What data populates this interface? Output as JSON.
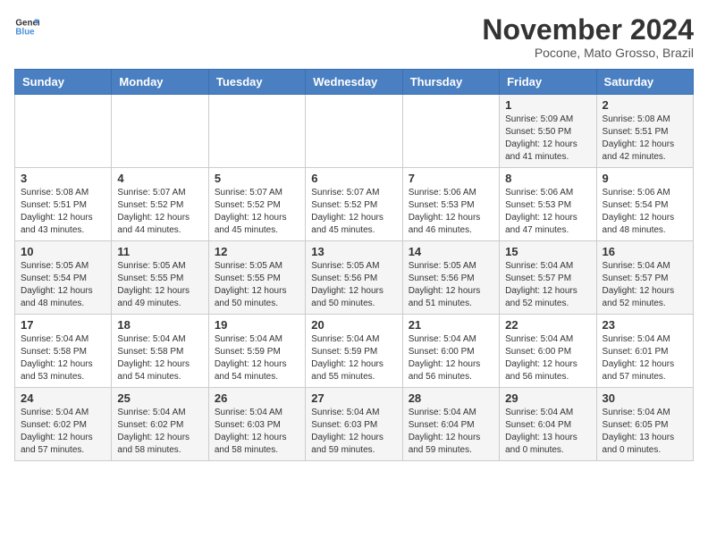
{
  "logo": {
    "line1": "General",
    "line2": "Blue"
  },
  "title": "November 2024",
  "subtitle": "Pocone, Mato Grosso, Brazil",
  "weekdays": [
    "Sunday",
    "Monday",
    "Tuesday",
    "Wednesday",
    "Thursday",
    "Friday",
    "Saturday"
  ],
  "weeks": [
    [
      {
        "day": "",
        "info": ""
      },
      {
        "day": "",
        "info": ""
      },
      {
        "day": "",
        "info": ""
      },
      {
        "day": "",
        "info": ""
      },
      {
        "day": "",
        "info": ""
      },
      {
        "day": "1",
        "info": "Sunrise: 5:09 AM\nSunset: 5:50 PM\nDaylight: 12 hours\nand 41 minutes."
      },
      {
        "day": "2",
        "info": "Sunrise: 5:08 AM\nSunset: 5:51 PM\nDaylight: 12 hours\nand 42 minutes."
      }
    ],
    [
      {
        "day": "3",
        "info": "Sunrise: 5:08 AM\nSunset: 5:51 PM\nDaylight: 12 hours\nand 43 minutes."
      },
      {
        "day": "4",
        "info": "Sunrise: 5:07 AM\nSunset: 5:52 PM\nDaylight: 12 hours\nand 44 minutes."
      },
      {
        "day": "5",
        "info": "Sunrise: 5:07 AM\nSunset: 5:52 PM\nDaylight: 12 hours\nand 45 minutes."
      },
      {
        "day": "6",
        "info": "Sunrise: 5:07 AM\nSunset: 5:52 PM\nDaylight: 12 hours\nand 45 minutes."
      },
      {
        "day": "7",
        "info": "Sunrise: 5:06 AM\nSunset: 5:53 PM\nDaylight: 12 hours\nand 46 minutes."
      },
      {
        "day": "8",
        "info": "Sunrise: 5:06 AM\nSunset: 5:53 PM\nDaylight: 12 hours\nand 47 minutes."
      },
      {
        "day": "9",
        "info": "Sunrise: 5:06 AM\nSunset: 5:54 PM\nDaylight: 12 hours\nand 48 minutes."
      }
    ],
    [
      {
        "day": "10",
        "info": "Sunrise: 5:05 AM\nSunset: 5:54 PM\nDaylight: 12 hours\nand 48 minutes."
      },
      {
        "day": "11",
        "info": "Sunrise: 5:05 AM\nSunset: 5:55 PM\nDaylight: 12 hours\nand 49 minutes."
      },
      {
        "day": "12",
        "info": "Sunrise: 5:05 AM\nSunset: 5:55 PM\nDaylight: 12 hours\nand 50 minutes."
      },
      {
        "day": "13",
        "info": "Sunrise: 5:05 AM\nSunset: 5:56 PM\nDaylight: 12 hours\nand 50 minutes."
      },
      {
        "day": "14",
        "info": "Sunrise: 5:05 AM\nSunset: 5:56 PM\nDaylight: 12 hours\nand 51 minutes."
      },
      {
        "day": "15",
        "info": "Sunrise: 5:04 AM\nSunset: 5:57 PM\nDaylight: 12 hours\nand 52 minutes."
      },
      {
        "day": "16",
        "info": "Sunrise: 5:04 AM\nSunset: 5:57 PM\nDaylight: 12 hours\nand 52 minutes."
      }
    ],
    [
      {
        "day": "17",
        "info": "Sunrise: 5:04 AM\nSunset: 5:58 PM\nDaylight: 12 hours\nand 53 minutes."
      },
      {
        "day": "18",
        "info": "Sunrise: 5:04 AM\nSunset: 5:58 PM\nDaylight: 12 hours\nand 54 minutes."
      },
      {
        "day": "19",
        "info": "Sunrise: 5:04 AM\nSunset: 5:59 PM\nDaylight: 12 hours\nand 54 minutes."
      },
      {
        "day": "20",
        "info": "Sunrise: 5:04 AM\nSunset: 5:59 PM\nDaylight: 12 hours\nand 55 minutes."
      },
      {
        "day": "21",
        "info": "Sunrise: 5:04 AM\nSunset: 6:00 PM\nDaylight: 12 hours\nand 56 minutes."
      },
      {
        "day": "22",
        "info": "Sunrise: 5:04 AM\nSunset: 6:00 PM\nDaylight: 12 hours\nand 56 minutes."
      },
      {
        "day": "23",
        "info": "Sunrise: 5:04 AM\nSunset: 6:01 PM\nDaylight: 12 hours\nand 57 minutes."
      }
    ],
    [
      {
        "day": "24",
        "info": "Sunrise: 5:04 AM\nSunset: 6:02 PM\nDaylight: 12 hours\nand 57 minutes."
      },
      {
        "day": "25",
        "info": "Sunrise: 5:04 AM\nSunset: 6:02 PM\nDaylight: 12 hours\nand 58 minutes."
      },
      {
        "day": "26",
        "info": "Sunrise: 5:04 AM\nSunset: 6:03 PM\nDaylight: 12 hours\nand 58 minutes."
      },
      {
        "day": "27",
        "info": "Sunrise: 5:04 AM\nSunset: 6:03 PM\nDaylight: 12 hours\nand 59 minutes."
      },
      {
        "day": "28",
        "info": "Sunrise: 5:04 AM\nSunset: 6:04 PM\nDaylight: 12 hours\nand 59 minutes."
      },
      {
        "day": "29",
        "info": "Sunrise: 5:04 AM\nSunset: 6:04 PM\nDaylight: 13 hours\nand 0 minutes."
      },
      {
        "day": "30",
        "info": "Sunrise: 5:04 AM\nSunset: 6:05 PM\nDaylight: 13 hours\nand 0 minutes."
      }
    ]
  ]
}
